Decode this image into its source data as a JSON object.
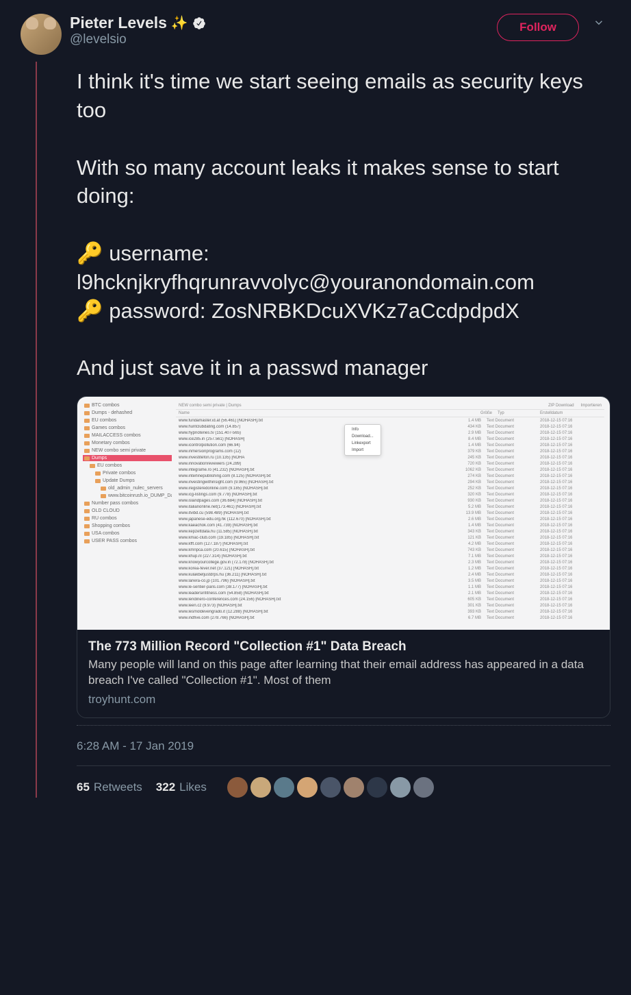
{
  "author": {
    "display_name": "Pieter Levels",
    "sparkle": "✨",
    "handle": "@levelsio"
  },
  "follow_label": "Follow",
  "tweet_text": {
    "line1": "I think it's time we start seeing emails as security keys too",
    "line2": "With so many account leaks it makes sense to start doing:",
    "key": "🔑",
    "username_label": " username: ",
    "username_value": "l9hcknjkryfhqrunravvolyc@youranondomain.com",
    "password_label": " password: ",
    "password_value": "ZosNRBKDcuXVKz7aCcdpdpdX",
    "line3": "And just save it in a passwd manager"
  },
  "card": {
    "title": "The 773 Million Record \"Collection #1\" Data Breach",
    "description": "Many people will land on this page after learning that their email address has appeared in a data breach I've called \"Collection #1\". Most of them",
    "domain": "troyhunt.com",
    "breadcrumb": "NEW combo semi private  |  Dumps",
    "toolbar": {
      "zip": "ZIP Download",
      "import": "Importieren"
    },
    "columns": {
      "name": "Name",
      "size": "Größe",
      "type": "Typ",
      "date": "Erstelldatum"
    },
    "sidebar": [
      {
        "label": "BTC combos"
      },
      {
        "label": "Dumps - dehashed"
      },
      {
        "label": "EU combos"
      },
      {
        "label": "Games combos"
      },
      {
        "label": "MAILACCESS combos"
      },
      {
        "label": "Monetary combos"
      },
      {
        "label": "NEW combo semi private"
      },
      {
        "label": "Dumps",
        "highlighted": true
      },
      {
        "label": "EU combos",
        "indent": 1
      },
      {
        "label": "Private combos",
        "indent": 2
      },
      {
        "label": "Update Dumps",
        "indent": 2
      },
      {
        "label": "old_admin_nulec_servers",
        "indent": 3
      },
      {
        "label": "www.bitcoinrush.io_DUMP_Data",
        "indent": 3
      },
      {
        "label": "Number pass combos"
      },
      {
        "label": "OLD CLOUD"
      },
      {
        "label": "RU combos"
      },
      {
        "label": "Shopping combos"
      },
      {
        "label": "USA combos"
      },
      {
        "label": "USER PASS combos"
      }
    ],
    "context_menu": [
      "Info",
      "Download...",
      "Linkexport",
      "Import"
    ],
    "files": [
      {
        "name": "www.fundamaster.id.at (56.461) [NOHASH].txt",
        "size": "1.4 MB",
        "type": "Text Document",
        "date": "2018-12-15 07:16"
      },
      {
        "name": "www.huntclubdating.com (14.857)",
        "size": "434 KB",
        "type": "Text Document",
        "date": "2018-12-15 07:16"
      },
      {
        "name": "www.hypnoteries.tv (151.407-565)",
        "size": "2.9 MB",
        "type": "Text Document",
        "date": "2018-12-15 07:16"
      },
      {
        "name": "www.ice285.in (257.561) [NOHASH]",
        "size": "8.4 MB",
        "type": "Text Document",
        "date": "2018-12-15 07:16"
      },
      {
        "name": "www.icontrolpollution.com (66.94)",
        "size": "1.4 MB",
        "type": "Text Document",
        "date": "2018-12-15 07:16"
      },
      {
        "name": "www.inmersionprograms.com (12)",
        "size": "379 KB",
        "type": "Text Document",
        "date": "2018-12-15 07:16"
      },
      {
        "name": "www.investitefon.ru (10.135) [NOHA",
        "size": "245 KB",
        "type": "Text Document",
        "date": "2018-12-15 07:16"
      },
      {
        "name": "www.innovationreviewers (24.289)",
        "size": "720 KB",
        "type": "Text Document",
        "date": "2018-12-15 07:16"
      },
      {
        "name": "www.integrame.ro (41.232) [NOHASH].txt",
        "size": "1062 KB",
        "type": "Text Document",
        "date": "2018-12-15 07:16"
      },
      {
        "name": "www.interlinepublishing.com (8.125) [NOHASH].txt",
        "size": "274 KB",
        "type": "Text Document",
        "date": "2018-12-15 07:16"
      },
      {
        "name": "www.investingwithinsight.com (9.965) [NOHASH].txt",
        "size": "294 KB",
        "type": "Text Document",
        "date": "2018-12-15 07:16"
      },
      {
        "name": "www.iregisteredonline.com (9.185) [NOHASH].txt",
        "size": "252 KB",
        "type": "Text Document",
        "date": "2018-12-15 07:16"
      },
      {
        "name": "www.icg-listings.com (9.778) [NOHASH].txt",
        "size": "320 KB",
        "type": "Text Document",
        "date": "2018-12-15 07:16"
      },
      {
        "name": "www.islandpages.com (36.684) [NOHASH].txt",
        "size": "930 KB",
        "type": "Text Document",
        "date": "2018-12-15 07:16"
      },
      {
        "name": "www.italianonline.net(173.461) [NOHASH].txt",
        "size": "5.2 MB",
        "type": "Text Document",
        "date": "2018-12-15 07:16"
      },
      {
        "name": "www.itvibd.cu (598.489) [NOHASH].txt",
        "size": "13.9 MB",
        "type": "Text Document",
        "date": "2018-12-15 07:16"
      },
      {
        "name": "www.japanese-edu.org.hk (112.670) [NOHASH].txt",
        "size": "2.6 MB",
        "type": "Text Document",
        "date": "2018-12-15 07:16"
      },
      {
        "name": "www.kaeachok.com (41.739) [NOHASH].txt",
        "size": "1.4 MB",
        "type": "Text Document",
        "date": "2018-12-15 07:16"
      },
      {
        "name": "www.kepzettdata.hu (11.585) [NOHASH].txt",
        "size": "343 KB",
        "type": "Text Document",
        "date": "2018-12-15 07:16"
      },
      {
        "name": "www.kmac-club.com (19.185) [NOHASH].txt",
        "size": "121 KB",
        "type": "Text Document",
        "date": "2018-12-15 07:16"
      },
      {
        "name": "www.kfft.com (127.187) [NOHASH].txt",
        "size": "4.2 MB",
        "type": "Text Document",
        "date": "2018-12-15 07:16"
      },
      {
        "name": "www.kmnpca.com (20.615) [NOHASH].txt",
        "size": "743 KB",
        "type": "Text Document",
        "date": "2018-12-15 07:16"
      },
      {
        "name": "www.khup.nl (227.314) [NOHASH].txt",
        "size": "7.1 MB",
        "type": "Text Document",
        "date": "2018-12-15 07:16"
      },
      {
        "name": "www.knowyourcollege.gov.in (72.178) [NOHASH].txt",
        "size": "2.3 MB",
        "type": "Text Document",
        "date": "2018-12-15 07:16"
      },
      {
        "name": "www.korea-fever.net (37.121) [NOHASH].txt",
        "size": "1.2 MB",
        "type": "Text Document",
        "date": "2018-12-15 07:16"
      },
      {
        "name": "www.kulakbetjustdrps.hu (36.211) [NOHASH].txt",
        "size": "2.4 MB",
        "type": "Text Document",
        "date": "2018-12-15 07:16"
      },
      {
        "name": "www.lanera-co.jp (101.796) [NOHASH].txt",
        "size": "3.5 MB",
        "type": "Text Document",
        "date": "2018-12-15 07:16"
      },
      {
        "name": "www.le-sentier-paris.com (38.177) [NOHASH].txt",
        "size": "1.1 MB",
        "type": "Text Document",
        "date": "2018-12-15 07:16"
      },
      {
        "name": "www.leadersinfitness.com (54.858) [NOHASH].txt",
        "size": "2.1 MB",
        "type": "Text Document",
        "date": "2018-12-15 07:16"
      },
      {
        "name": "www.lendinero-conferences.com (24.156) [NOHASH].txt",
        "size": "605 KB",
        "type": "Text Document",
        "date": "2018-12-15 07:16"
      },
      {
        "name": "www.leen.cz (9.973) [NOHASH].txt",
        "size": "301 KB",
        "type": "Text Document",
        "date": "2018-12-15 07:16"
      },
      {
        "name": "www.lesmoldevengrado.it (12.288) [NOHASH].txt",
        "size": "393 KB",
        "type": "Text Document",
        "date": "2018-12-15 07:16"
      },
      {
        "name": "www.indfive.com (278.766) [NOHASH].txt",
        "size": "6.7 MB",
        "type": "Text Document",
        "date": "2018-12-15 07:16"
      }
    ]
  },
  "timestamp": "6:28 AM - 17 Jan 2019",
  "stats": {
    "retweets_count": "65",
    "retweets_label": "Retweets",
    "likes_count": "322",
    "likes_label": "Likes"
  }
}
